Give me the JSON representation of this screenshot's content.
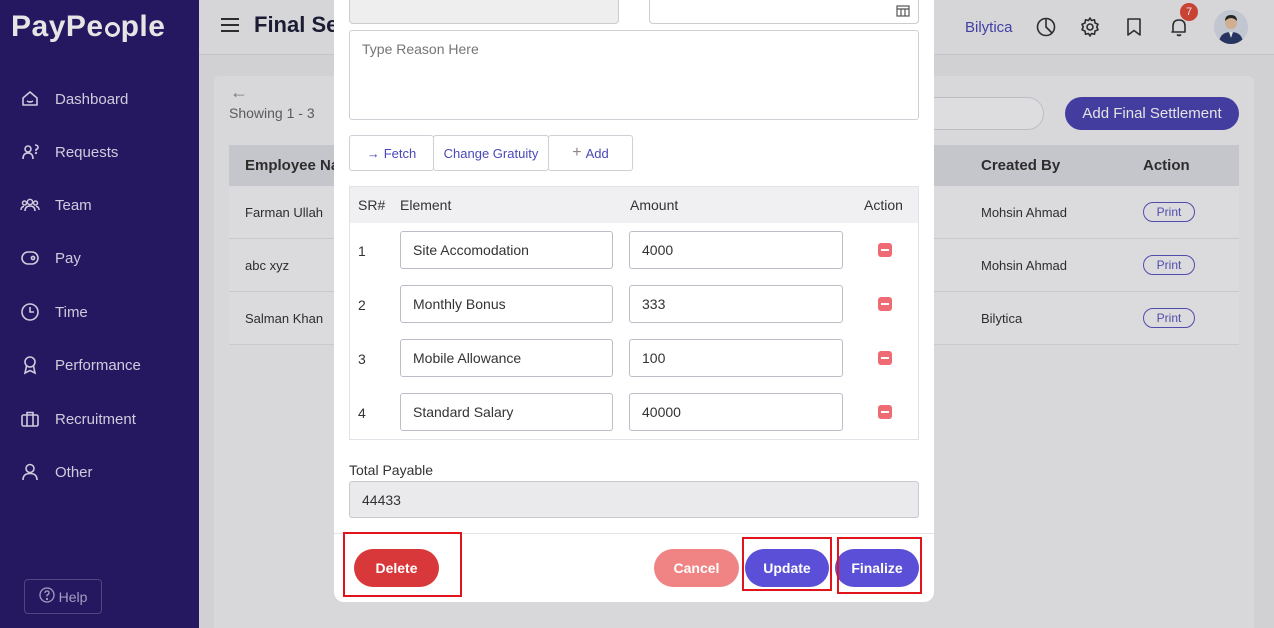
{
  "app": {
    "logo_pre": "PayPe",
    "logo_post": "ple"
  },
  "sidebar": {
    "items": [
      {
        "label": "Dashboard",
        "icon": "home-icon"
      },
      {
        "label": "Requests",
        "icon": "requests-icon"
      },
      {
        "label": "Team",
        "icon": "team-icon"
      },
      {
        "label": "Pay",
        "icon": "pay-icon"
      },
      {
        "label": "Time",
        "icon": "clock-icon"
      },
      {
        "label": "Performance",
        "icon": "award-icon"
      },
      {
        "label": "Recruitment",
        "icon": "briefcase-icon"
      },
      {
        "label": "Other",
        "icon": "user-icon"
      }
    ],
    "help_label": "Help"
  },
  "header": {
    "title": "Final Se",
    "company": "Bilytica",
    "notification_count": "7"
  },
  "list": {
    "showing": "Showing 1 - 3",
    "add_button": "Add Final Settlement",
    "columns": {
      "employee": "Employee Na",
      "created_by": "Created By",
      "action": "Action"
    },
    "rows": [
      {
        "employee": "Farman Ullah",
        "created_by": "Mohsin Ahmad",
        "action": "Print"
      },
      {
        "employee": "abc xyz",
        "created_by": "Mohsin Ahmad",
        "action": "Print"
      },
      {
        "employee": "Salman Khan",
        "created_by": "Bilytica",
        "action": "Print"
      }
    ]
  },
  "modal": {
    "reason_placeholder": "Type Reason Here",
    "buttons": {
      "fetch": "Fetch",
      "change_gratuity": "Change Gratuity",
      "add": "Add"
    },
    "table": {
      "columns": {
        "sr": "SR#",
        "element": "Element",
        "amount": "Amount",
        "action": "Action"
      },
      "rows": [
        {
          "sr": "1",
          "element": "Site Accomodation",
          "amount": "4000"
        },
        {
          "sr": "2",
          "element": "Monthly Bonus",
          "amount": "333"
        },
        {
          "sr": "3",
          "element": "Mobile Allowance",
          "amount": "100"
        },
        {
          "sr": "4",
          "element": "Standard Salary",
          "amount": "40000"
        }
      ]
    },
    "total_label": "Total Payable",
    "total_value": "44433",
    "footer": {
      "delete": "Delete",
      "cancel": "Cancel",
      "update": "Update",
      "finalize": "Finalize"
    }
  },
  "colors": {
    "sidebar": "#2a1a6b",
    "accent": "#5a4fd6",
    "delete": "#d9383a",
    "cancel": "#f08383"
  }
}
